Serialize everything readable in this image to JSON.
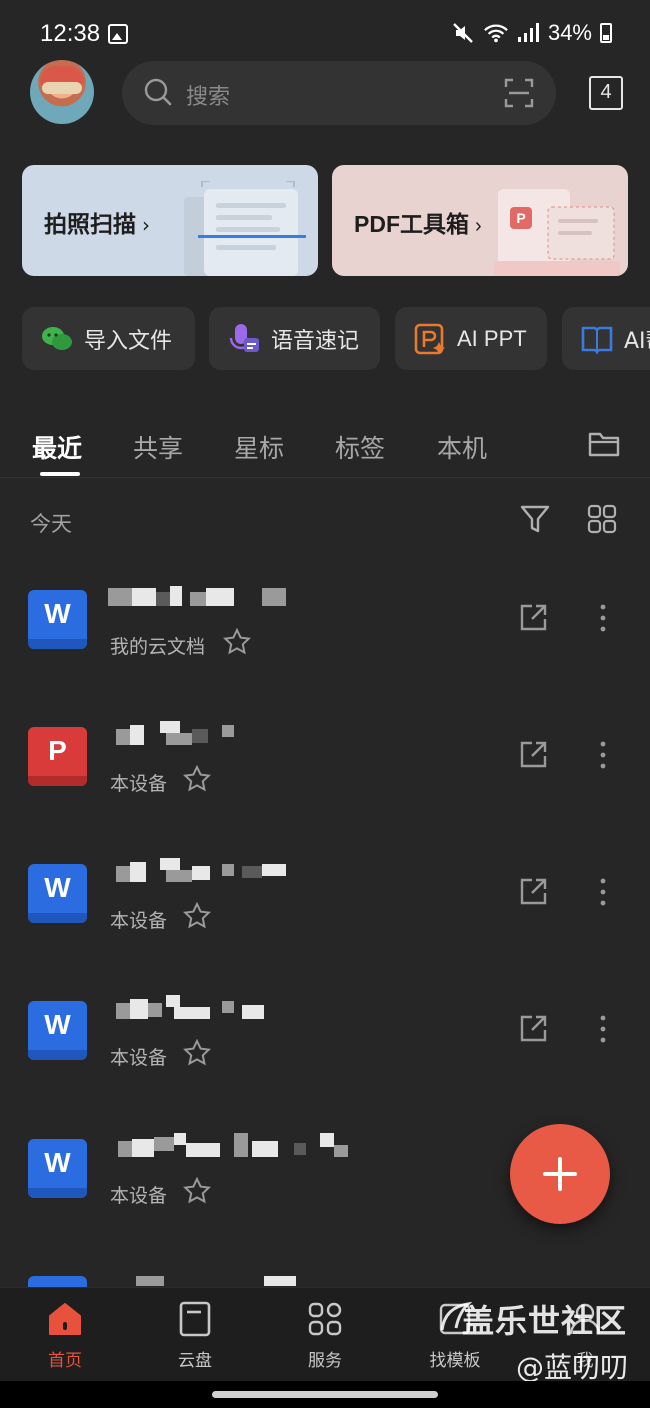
{
  "status_bar": {
    "time": "12:38",
    "battery": "34%"
  },
  "header": {
    "search_placeholder": "搜索",
    "tab_count": "4"
  },
  "cards": [
    {
      "label": "拍照扫描",
      "chevron": "›"
    },
    {
      "label": "PDF工具箱",
      "chevron": "›"
    }
  ],
  "quick_actions": [
    {
      "label": "导入文件",
      "icon": "wechat-icon"
    },
    {
      "label": "语音速记",
      "icon": "voice-note-icon"
    },
    {
      "label": "AI PPT",
      "icon": "ai-ppt-icon"
    },
    {
      "label": "AI帮",
      "icon": "ai-book-icon"
    }
  ],
  "tabs": [
    "最近",
    "共享",
    "星标",
    "标签",
    "本机"
  ],
  "section": {
    "title": "今天"
  },
  "files": [
    {
      "type": "word",
      "glyph": "W",
      "location": "我的云文档"
    },
    {
      "type": "pdf",
      "glyph": "P",
      "location": "本设备"
    },
    {
      "type": "word",
      "glyph": "W",
      "location": "本设备"
    },
    {
      "type": "word",
      "glyph": "W",
      "location": "本设备"
    },
    {
      "type": "word",
      "glyph": "W",
      "location": "本设备"
    }
  ],
  "bottom_nav": [
    {
      "label": "首页",
      "icon": "home-icon",
      "active": true
    },
    {
      "label": "云盘",
      "icon": "cloud-drive-icon",
      "active": false
    },
    {
      "label": "服务",
      "icon": "services-icon",
      "active": false
    },
    {
      "label": "找模板",
      "icon": "template-icon",
      "active": false
    },
    {
      "label": "我",
      "icon": "profile-icon",
      "active": false
    }
  ],
  "watermark": {
    "line1": "盖乐世社区",
    "line2": "@蓝叨叨"
  },
  "colors": {
    "background": "#262626",
    "accent": "#e8523c",
    "word": "#2b6de0",
    "pdf": "#d93b3b"
  }
}
